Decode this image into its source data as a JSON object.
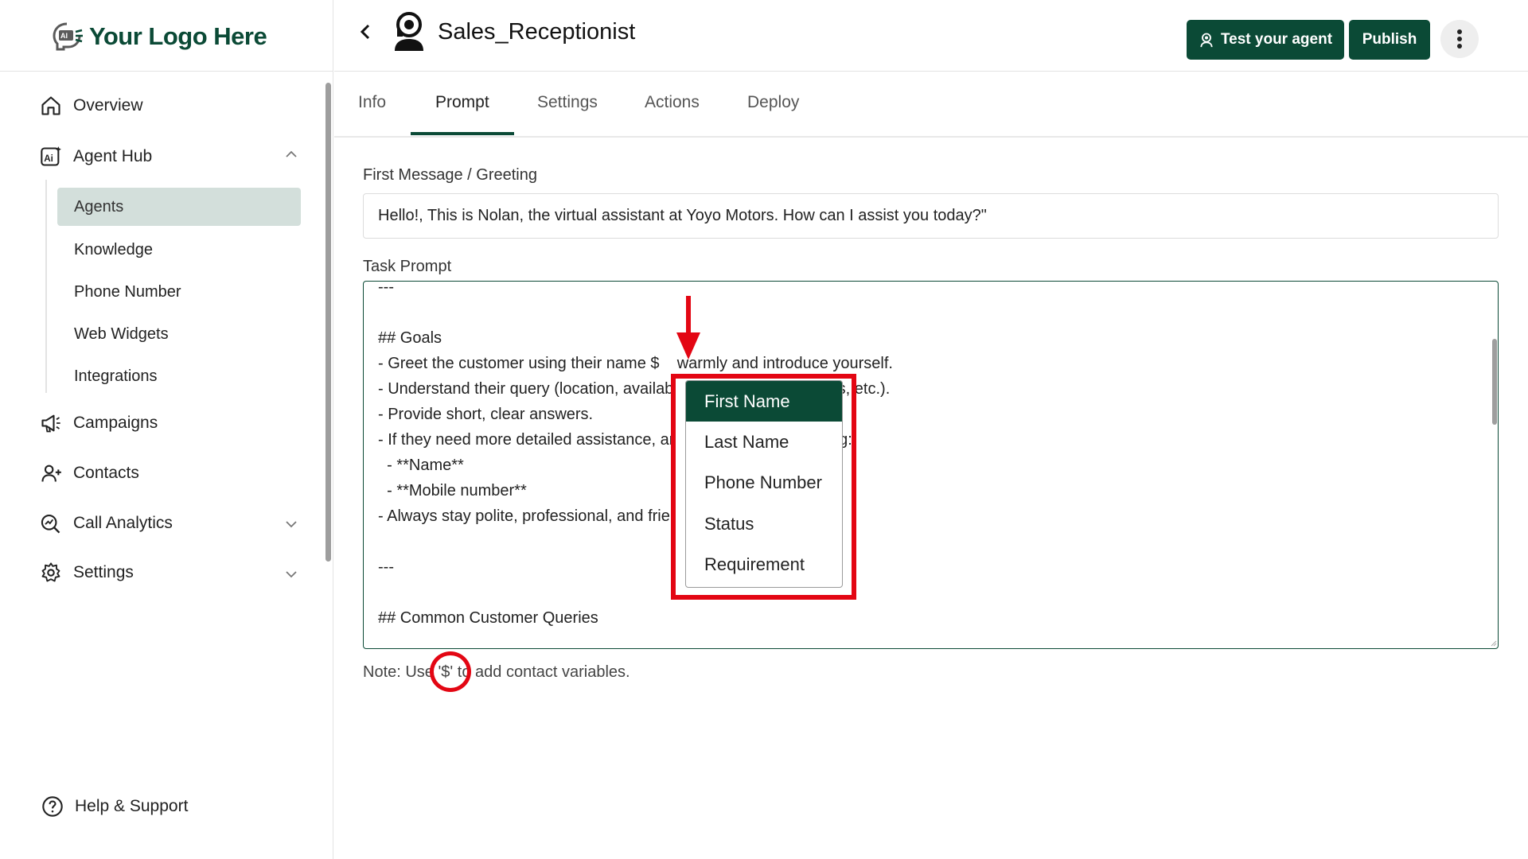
{
  "brand": {
    "logo_text": "Your Logo Here",
    "logo_badge": "AI",
    "accent": "#0b4a36"
  },
  "sidebar": {
    "nav": [
      {
        "label": "Overview",
        "icon": "home-icon"
      },
      {
        "label": "Agent Hub",
        "icon": "ai-icon"
      },
      {
        "label": "Campaigns",
        "icon": "megaphone-icon"
      },
      {
        "label": "Contacts",
        "icon": "user-plus-icon"
      },
      {
        "label": "Call Analytics",
        "icon": "analytics-icon"
      },
      {
        "label": "Settings",
        "icon": "settings-icon"
      }
    ],
    "agent_hub_items": [
      {
        "label": "Agents",
        "active": true
      },
      {
        "label": "Knowledge"
      },
      {
        "label": "Phone Number"
      },
      {
        "label": "Web Widgets"
      },
      {
        "label": "Integrations"
      }
    ],
    "help_label": "Help & Support"
  },
  "header": {
    "agent_name": "Sales_Receptionist",
    "test_button": "Test your agent",
    "publish_button": "Publish"
  },
  "tabs": [
    {
      "label": "Info"
    },
    {
      "label": "Prompt",
      "active": true
    },
    {
      "label": "Settings"
    },
    {
      "label": "Actions"
    },
    {
      "label": "Deploy"
    }
  ],
  "form": {
    "greeting_label": "First Message / Greeting",
    "greeting_value": "Hello!, This is Nolan, the virtual assistant at Yoyo Motors. How can I assist you today?\"",
    "task_label": "Task Prompt",
    "prompt_lines": [
      "---",
      "",
      "## Goals",
      "- Greet the customer using their name $    warmly and introduce yourself.",
      "- Understand their query (location, availab                         ge offers, etc.).",
      "- Provide short, clear answers.",
      "- If they need more detailed assistance, ar                          ollecting:",
      "  - **Name**",
      "  - **Mobile number**",
      "- Always stay polite, professional, and frie",
      "",
      "---",
      "",
      "## Common Customer Queries"
    ],
    "note": "Note: Use '$' to add contact variables."
  },
  "variable_dropdown": {
    "options": [
      "First Name",
      "Last Name",
      "Phone Number",
      "Status",
      "Requirement"
    ],
    "highlighted": "First Name"
  },
  "annotation_color": "#e30613"
}
